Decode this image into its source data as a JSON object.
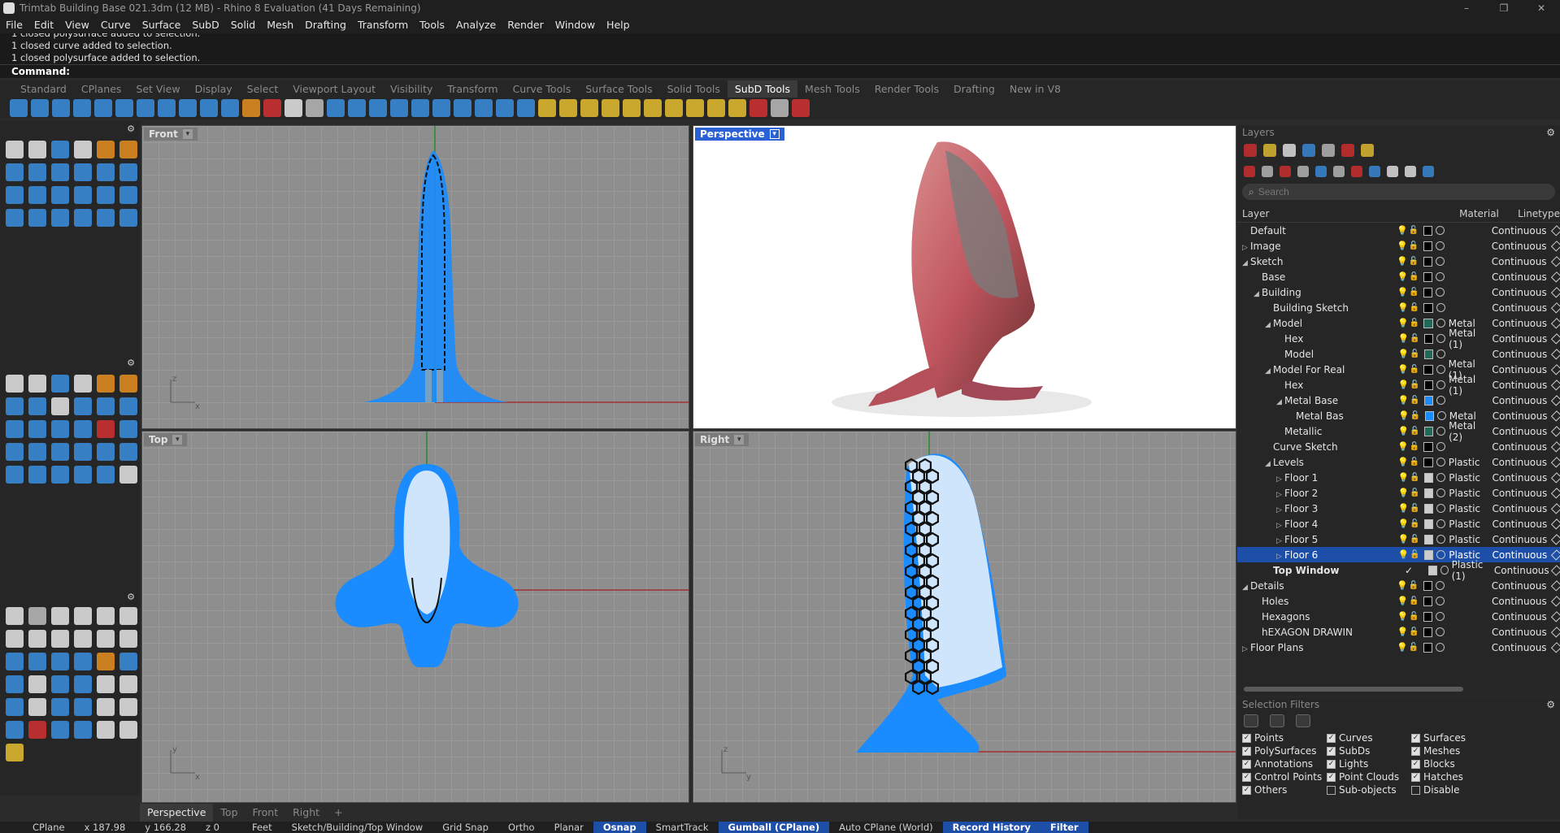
{
  "window": {
    "title": "Trimtab Building Base 021.3dm (12 MB) - Rhino 8 Evaluation (41 Days Remaining)",
    "controls": [
      "–",
      "❐",
      "✕"
    ]
  },
  "menu": [
    "File",
    "Edit",
    "View",
    "Curve",
    "Surface",
    "SubD",
    "Solid",
    "Mesh",
    "Drafting",
    "Transform",
    "Tools",
    "Analyze",
    "Render",
    "Window",
    "Help"
  ],
  "command_history": [
    "1 closed polysurface added to selection.",
    "1 closed curve added to selection.",
    "1 closed polysurface added to selection."
  ],
  "command": {
    "label": "Command:",
    "value": ""
  },
  "toolbar_tabs": [
    "Standard",
    "CPlanes",
    "Set View",
    "Display",
    "Select",
    "Viewport Layout",
    "Visibility",
    "Transform",
    "Curve Tools",
    "Surface Tools",
    "Solid Tools",
    "SubD Tools",
    "Mesh Tools",
    "Render Tools",
    "Drafting",
    "New in V8"
  ],
  "active_toolbar_tab": "SubD Tools",
  "icon_colors": {
    "blue": "#3a8fe0",
    "yellow": "#e8c030",
    "red": "#d43030",
    "gray": "#bdbdbd",
    "white": "#e8e8e8",
    "orange": "#e89020",
    "selection": "#1e4fa8",
    "wire_blue": "#1a8cff"
  },
  "viewports": {
    "front": {
      "label": "Front"
    },
    "perspective": {
      "label": "Perspective"
    },
    "top": {
      "label": "Top"
    },
    "right": {
      "label": "Right"
    }
  },
  "viewport_tabs": [
    "Perspective",
    "Top",
    "Front",
    "Right",
    "+"
  ],
  "status": {
    "cplane": "CPlane",
    "x": "x 187.98",
    "y": "y 166.28",
    "z": "z 0",
    "units": "Feet",
    "layer": "Sketch/Building/Top Window",
    "toggles": [
      {
        "label": "Grid Snap",
        "on": false
      },
      {
        "label": "Ortho",
        "on": false
      },
      {
        "label": "Planar",
        "on": false
      },
      {
        "label": "Osnap",
        "on": true
      },
      {
        "label": "SmartTrack",
        "on": false
      },
      {
        "label": "Gumball (CPlane)",
        "on": true
      },
      {
        "label": "Auto CPlane (World)",
        "on": false
      },
      {
        "label": "Record History",
        "on": true
      },
      {
        "label": "Filter",
        "on": true
      }
    ]
  },
  "layers_panel": {
    "title": "Layers",
    "search_placeholder": "Search",
    "columns": {
      "name": "Layer",
      "material": "Material",
      "linetype": "Linetype"
    },
    "rows": [
      {
        "name": "Default",
        "indent": 0,
        "arrow": "",
        "material": "",
        "linetype": "Continuous",
        "swatch": "#000000"
      },
      {
        "name": "Image",
        "indent": 0,
        "arrow": "▷",
        "material": "",
        "linetype": "Continuous",
        "swatch": "#000000"
      },
      {
        "name": "Sketch",
        "indent": 0,
        "arrow": "◢",
        "material": "",
        "linetype": "Continuous",
        "swatch": "#000000"
      },
      {
        "name": "Base",
        "indent": 1,
        "arrow": "",
        "material": "",
        "linetype": "Continuous",
        "swatch": "#000000"
      },
      {
        "name": "Building",
        "indent": 1,
        "arrow": "◢",
        "material": "",
        "linetype": "Continuous",
        "swatch": "#000000"
      },
      {
        "name": "Building Sketch",
        "indent": 2,
        "arrow": "",
        "material": "",
        "linetype": "Continuous",
        "swatch": "#000000"
      },
      {
        "name": "Model",
        "indent": 2,
        "arrow": "◢",
        "material": "Metal",
        "linetype": "Continuous",
        "swatch": "#1f6a5a"
      },
      {
        "name": "Hex",
        "indent": 3,
        "arrow": "",
        "material": "Metal (1)",
        "linetype": "Continuous",
        "swatch": "#000000"
      },
      {
        "name": "Model",
        "indent": 3,
        "arrow": "",
        "material": "",
        "linetype": "Continuous",
        "swatch": "#1f6a5a"
      },
      {
        "name": "Model For Real",
        "indent": 2,
        "arrow": "◢",
        "material": "Metal (1)",
        "linetype": "Continuous",
        "swatch": "#000000"
      },
      {
        "name": "Hex",
        "indent": 3,
        "arrow": "",
        "material": "Metal (1)",
        "linetype": "Continuous",
        "swatch": "#000000"
      },
      {
        "name": "Metal Base",
        "indent": 3,
        "arrow": "◢",
        "material": "",
        "linetype": "Continuous",
        "swatch": "#1a8cff"
      },
      {
        "name": "Metal Bas",
        "indent": 4,
        "arrow": "",
        "material": "Metal",
        "linetype": "Continuous",
        "swatch": "#1a8cff"
      },
      {
        "name": "Metallic",
        "indent": 3,
        "arrow": "",
        "material": "Metal (2)",
        "linetype": "Continuous",
        "swatch": "#1f6a5a"
      },
      {
        "name": "Curve Sketch",
        "indent": 2,
        "arrow": "",
        "material": "",
        "linetype": "Continuous",
        "swatch": "#000000"
      },
      {
        "name": "Levels",
        "indent": 2,
        "arrow": "◢",
        "material": "Plastic",
        "linetype": "Continuous",
        "swatch": "#000000"
      },
      {
        "name": "Floor 1",
        "indent": 3,
        "arrow": "▷",
        "material": "Plastic",
        "linetype": "Continuous",
        "swatch": "#cccccc"
      },
      {
        "name": "Floor 2",
        "indent": 3,
        "arrow": "▷",
        "material": "Plastic",
        "linetype": "Continuous",
        "swatch": "#cccccc"
      },
      {
        "name": "Floor 3",
        "indent": 3,
        "arrow": "▷",
        "material": "Plastic",
        "linetype": "Continuous",
        "swatch": "#cccccc"
      },
      {
        "name": "Floor 4",
        "indent": 3,
        "arrow": "▷",
        "material": "Plastic",
        "linetype": "Continuous",
        "swatch": "#cccccc"
      },
      {
        "name": "Floor 5",
        "indent": 3,
        "arrow": "▷",
        "material": "Plastic",
        "linetype": "Continuous",
        "swatch": "#cccccc"
      },
      {
        "name": "Floor 6",
        "indent": 3,
        "arrow": "▷",
        "material": "Plastic",
        "linetype": "Continuous",
        "swatch": "#cccccc",
        "selected": true
      },
      {
        "name": "Top Window",
        "indent": 2,
        "arrow": "",
        "material": "Plastic (1)",
        "linetype": "Continuous",
        "swatch": "#cccccc",
        "current": true,
        "check": "✓"
      },
      {
        "name": "Details",
        "indent": 0,
        "arrow": "◢",
        "material": "",
        "linetype": "Continuous",
        "swatch": "#000000"
      },
      {
        "name": "Holes",
        "indent": 1,
        "arrow": "",
        "material": "",
        "linetype": "Continuous",
        "swatch": "#000000"
      },
      {
        "name": "Hexagons",
        "indent": 1,
        "arrow": "",
        "material": "",
        "linetype": "Continuous",
        "swatch": "#000000"
      },
      {
        "name": "hEXAGON DRAWIN",
        "indent": 1,
        "arrow": "",
        "material": "",
        "linetype": "Continuous",
        "swatch": "#000000"
      },
      {
        "name": "Floor Plans",
        "indent": 0,
        "arrow": "▷",
        "material": "",
        "linetype": "Continuous",
        "swatch": "#000000"
      }
    ]
  },
  "selection_filters": {
    "title": "Selection Filters",
    "items": [
      {
        "label": "Points",
        "checked": true
      },
      {
        "label": "Curves",
        "checked": true
      },
      {
        "label": "Surfaces",
        "checked": true
      },
      {
        "label": "PolySurfaces",
        "checked": true
      },
      {
        "label": "SubDs",
        "checked": true
      },
      {
        "label": "Meshes",
        "checked": true
      },
      {
        "label": "Annotations",
        "checked": true
      },
      {
        "label": "Lights",
        "checked": true
      },
      {
        "label": "Blocks",
        "checked": true
      },
      {
        "label": "Control Points",
        "checked": true
      },
      {
        "label": "Point Clouds",
        "checked": true
      },
      {
        "label": "Hatches",
        "checked": true
      },
      {
        "label": "Others",
        "checked": true
      },
      {
        "label": "Sub-objects",
        "checked": false
      },
      {
        "label": "Disable",
        "checked": false
      }
    ]
  }
}
